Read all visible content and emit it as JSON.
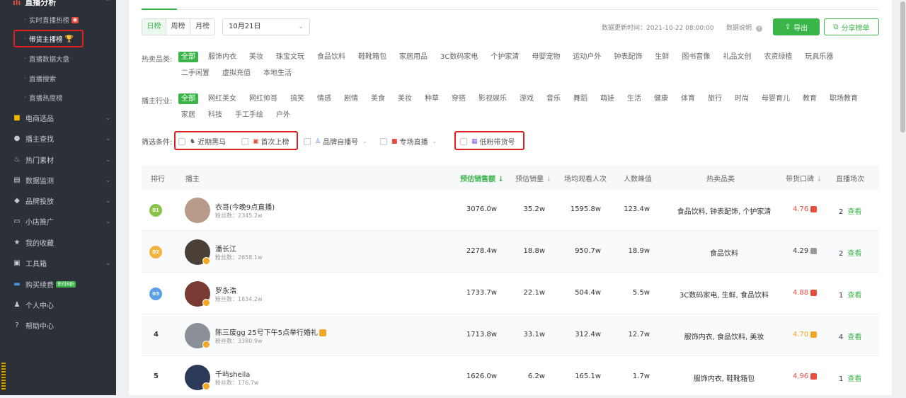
{
  "sidebar": {
    "section_title": "直播分析",
    "sub_items": [
      {
        "label": "实时直播热榜",
        "badge": "hot"
      },
      {
        "label": "带货主播榜",
        "badge": "trophy",
        "active": true
      },
      {
        "label": "直播数据大盘"
      },
      {
        "label": "直播搜索"
      },
      {
        "label": "直播热度榜"
      }
    ],
    "main_items": [
      {
        "label": "电商选品",
        "icon": "bag-icon",
        "chevron": true
      },
      {
        "label": "播主查找",
        "icon": "search-icon",
        "chevron": true
      },
      {
        "label": "热门素材",
        "icon": "fire-icon",
        "chevron": true
      },
      {
        "label": "数据监测",
        "icon": "chart-icon",
        "chevron": true
      },
      {
        "label": "品牌投放",
        "icon": "brand-icon",
        "chevron": true
      },
      {
        "label": "小店推广",
        "icon": "shop-icon",
        "chevron": true
      },
      {
        "label": "我的收藏",
        "icon": "star-icon",
        "chevron": false
      },
      {
        "label": "工具箱",
        "icon": "toolbox-icon",
        "chevron": true
      },
      {
        "label": "购买续费",
        "icon": "card-icon",
        "chevron": false,
        "badge": "年付6折"
      },
      {
        "label": "个人中心",
        "icon": "user-icon",
        "chevron": false
      },
      {
        "label": "帮助中心",
        "icon": "help-icon",
        "chevron": false
      }
    ]
  },
  "toolbar": {
    "period_tabs": [
      "日榜",
      "周榜",
      "月榜"
    ],
    "active_period": "日榜",
    "date_value": "10月21日",
    "update_time_label": "数据更新时间：2021-10-22 08:00:00",
    "data_note_label": "数据说明",
    "export_label": "导出",
    "share_label": "分享榜单"
  },
  "filters": {
    "category_label": "热卖品类:",
    "categories": [
      "全部",
      "服饰内衣",
      "美妆",
      "珠宝文玩",
      "食品饮料",
      "鞋靴箱包",
      "家居用品",
      "3C数码家电",
      "个护家清",
      "母婴宠物",
      "运动户外",
      "钟表配饰",
      "生鲜",
      "图书音像",
      "礼品文创",
      "农资绿植",
      "玩具乐器",
      "二手闲置",
      "虚拟充值",
      "本地生活"
    ],
    "industry_label": "播主行业:",
    "industries": [
      "全部",
      "网红美女",
      "网红帅哥",
      "搞笑",
      "情感",
      "剧情",
      "美食",
      "美妆",
      "种草",
      "穿搭",
      "影视娱乐",
      "游戏",
      "音乐",
      "舞蹈",
      "萌娃",
      "生活",
      "健康",
      "体育",
      "旅行",
      "时尚",
      "母婴育儿",
      "教育",
      "职场教育",
      "家居",
      "科技",
      "手工手绘",
      "户外"
    ],
    "condition_label": "筛选条件:",
    "conditions": [
      {
        "label": "近期黑马",
        "icon": "horse-icon"
      },
      {
        "label": "首次上榜",
        "icon": "new-icon"
      },
      {
        "label": "品牌自播号",
        "icon": "brand-self-icon",
        "dropdown": true
      },
      {
        "label": "专场直播",
        "icon": "camera-icon",
        "dropdown": true
      },
      {
        "label": "低粉带货号",
        "icon": "low-fans-icon"
      }
    ]
  },
  "table": {
    "columns": [
      "排行",
      "播主",
      "预估销售额",
      "预估销量",
      "场均观看人次",
      "人数峰值",
      "热卖品类",
      "带货口碑",
      "直播场次"
    ],
    "view_label": "查看",
    "fans_prefix": "粉丝数：",
    "rows": [
      {
        "rank": "01",
        "name": "衣哥(今晚9点直播)",
        "fans": "2345.2w",
        "sales": "3076.0w",
        "volume": "35.2w",
        "avg_views": "1595.8w",
        "peak": "123.4w",
        "categories": "食品饮料, 钟表配饰, 个护家清",
        "rating": "4.76",
        "rating_color": "#e84c3d",
        "sessions": "2"
      },
      {
        "rank": "02",
        "name": "潘长江",
        "fans": "2658.1w",
        "sales": "2278.4w",
        "volume": "18.8w",
        "avg_views": "950.7w",
        "peak": "18.9w",
        "categories": "食品饮料",
        "rating": "4.29",
        "rating_color": "#333333",
        "sessions": "2"
      },
      {
        "rank": "03",
        "name": "罗永浩",
        "fans": "1834.2w",
        "sales": "1733.7w",
        "volume": "22.1w",
        "avg_views": "504.4w",
        "peak": "5.5w",
        "categories": "3C数码家电, 生鲜, 食品饮料",
        "rating": "4.88",
        "rating_color": "#e84c3d",
        "sessions": "1"
      },
      {
        "rank": "4",
        "name": "陈三废gg 25号下午5点举行婚礼",
        "fans": "3380.9w",
        "sales": "1713.8w",
        "volume": "33.1w",
        "avg_views": "312.4w",
        "peak": "12.7w",
        "categories": "服饰内衣, 食品饮料, 美妆",
        "rating": "4.70",
        "rating_color": "#f5a623",
        "sessions": "4"
      },
      {
        "rank": "5",
        "name": "千屿sheila",
        "fans": "176.7w",
        "sales": "1626.0w",
        "volume": "6.2w",
        "avg_views": "165.1w",
        "peak": "1.7w",
        "categories": "服饰内衣, 鞋靴箱包",
        "rating": "4.96",
        "rating_color": "#e84c3d",
        "sessions": "1"
      }
    ]
  },
  "colors": {
    "accent": "#3bb54a",
    "highlight_box": "#e02020",
    "sidebar_bg": "#2c3038"
  }
}
